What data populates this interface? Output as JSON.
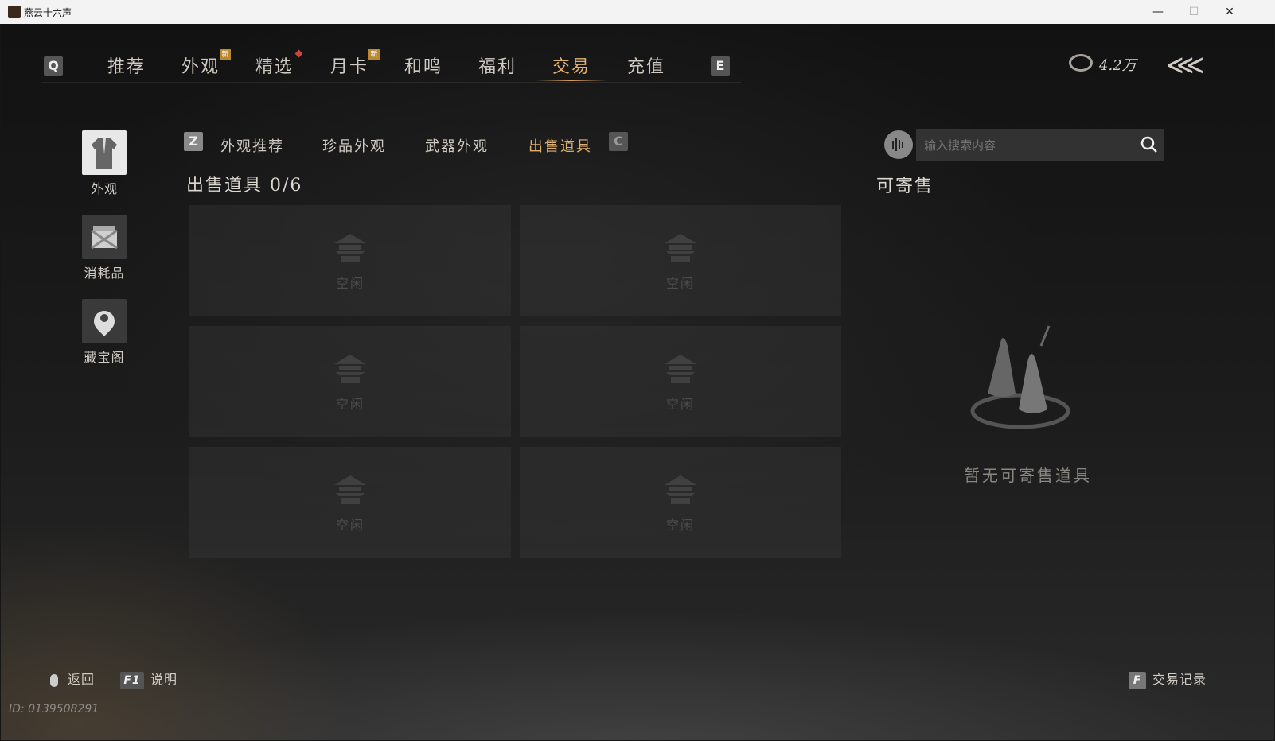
{
  "window": {
    "title": "燕云十六声",
    "minimize": "—",
    "maximize": "☐",
    "close": "✕"
  },
  "nav": {
    "left_key": "Q",
    "right_key": "E",
    "tabs": [
      {
        "label": "推荐"
      },
      {
        "label": "外观",
        "badge": "新"
      },
      {
        "label": "精选"
      },
      {
        "label": "月卡",
        "badge": "新"
      },
      {
        "label": "和鸣"
      },
      {
        "label": "福利"
      },
      {
        "label": "交易",
        "active": true
      },
      {
        "label": "充值"
      }
    ]
  },
  "currency": {
    "amount": "4.2万",
    "icon": "coin-icon"
  },
  "sidebar": {
    "items": [
      {
        "label": "外观",
        "icon": "robe-icon",
        "active": true
      },
      {
        "label": "消耗品",
        "icon": "package-icon"
      },
      {
        "label": "藏宝阁",
        "icon": "treasure-icon"
      }
    ]
  },
  "subtabs": {
    "left_key": "Z",
    "right_key": "C",
    "items": [
      {
        "label": "外观推荐"
      },
      {
        "label": "珍品外观"
      },
      {
        "label": "武器外观"
      },
      {
        "label": "出售道具",
        "active": true
      }
    ]
  },
  "listing": {
    "title": "出售道具 0/6",
    "slots": [
      "空闲",
      "空闲",
      "空闲",
      "空闲",
      "空闲",
      "空闲"
    ]
  },
  "search": {
    "placeholder": "输入搜索内容"
  },
  "sellable": {
    "title": "可寄售",
    "empty_text": "暂无可寄售道具"
  },
  "footer": {
    "back": "返回",
    "help_key": "F1",
    "help": "说明",
    "records_key": "F",
    "records": "交易记录",
    "id": "ID: 0139508291"
  },
  "colors": {
    "accent": "#e0b070",
    "badge": "#b8892f",
    "alert": "#c8483b"
  }
}
